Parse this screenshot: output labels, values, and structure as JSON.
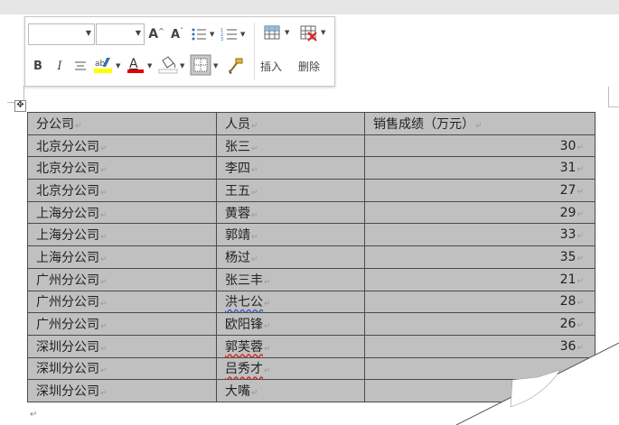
{
  "toolbar": {
    "font_name": "",
    "font_size": "",
    "grow_font": "A",
    "shrink_font": "A",
    "bold": "B",
    "italic": "I",
    "font_color": "A",
    "insert_label": "插入",
    "delete_label": "删除"
  },
  "table": {
    "headers": [
      "分公司",
      "人员",
      "销售成绩（万元）"
    ],
    "rows": [
      {
        "branch": "北京分公司",
        "person": "张三",
        "score": "30"
      },
      {
        "branch": "北京分公司",
        "person": "李四",
        "score": "31"
      },
      {
        "branch": "北京分公司",
        "person": "王五",
        "score": "27"
      },
      {
        "branch": "上海分公司",
        "person": "黄蓉",
        "score": "29"
      },
      {
        "branch": "上海分公司",
        "person": "郭靖",
        "score": "33"
      },
      {
        "branch": "上海分公司",
        "person": "杨过",
        "score": "35"
      },
      {
        "branch": "广州分公司",
        "person": "张三丰",
        "score": "21"
      },
      {
        "branch": "广州分公司",
        "person": "洪七公",
        "score": "28"
      },
      {
        "branch": "广州分公司",
        "person": "欧阳锋",
        "score": "26"
      },
      {
        "branch": "深圳分公司",
        "person": "郭芙蓉",
        "score": "36"
      },
      {
        "branch": "深圳分公司",
        "person": "吕秀才",
        "score": ""
      },
      {
        "branch": "深圳分公司",
        "person": "大嘴",
        "score": ""
      }
    ]
  },
  "marks": {
    "cell_end": "↵",
    "paragraph_end": "↵",
    "move_handle": "✥"
  },
  "colors": {
    "selection_gray": "#c0c0c0",
    "highlight_yellow": "#ffff00",
    "font_color_red": "#e00000"
  }
}
